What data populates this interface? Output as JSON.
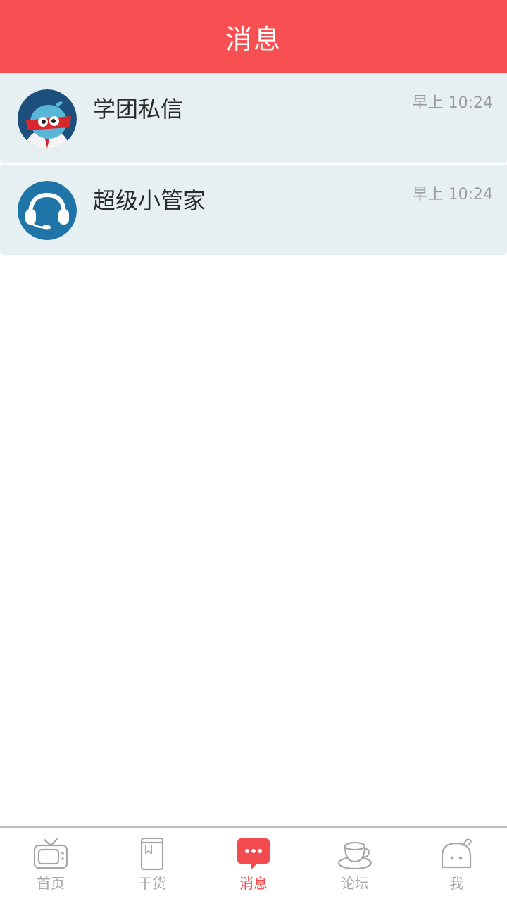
{
  "header": {
    "title": "消息"
  },
  "messages": [
    {
      "title": "学团私信",
      "time": "早上 10:24",
      "avatar": "mascot-avatar-icon"
    },
    {
      "title": "超级小管家",
      "time": "早上 10:24",
      "avatar": "headset-avatar-icon"
    }
  ],
  "tabbar": {
    "active": "messages",
    "tabs": [
      {
        "label": "首页",
        "icon": "tv-icon"
      },
      {
        "label": "干货",
        "icon": "book-icon"
      },
      {
        "label": "消息",
        "icon": "chat-bubble-icon"
      },
      {
        "label": "论坛",
        "icon": "coffee-cup-icon"
      },
      {
        "label": "我",
        "icon": "ghost-icon"
      }
    ]
  },
  "colors": {
    "header": "#f84f52",
    "list_bg": "#e6eff1",
    "active_tab": "#f24b4f",
    "inactive_tab": "#a7a7a7"
  }
}
